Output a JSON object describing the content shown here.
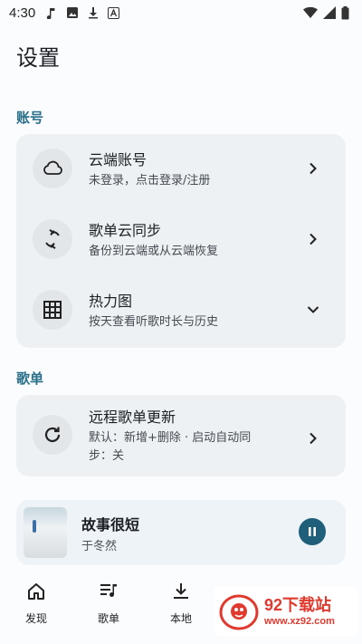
{
  "status_bar": {
    "time": "4:30"
  },
  "page": {
    "title": "设置"
  },
  "sections": {
    "account_label": "账号",
    "playlist_label": "歌单"
  },
  "account_rows": [
    {
      "title": "云端账号",
      "subtitle": "未登录，点击登录/注册",
      "icon": "cloud-icon",
      "trailing": "chevron-right-icon"
    },
    {
      "title": "歌单云同步",
      "subtitle": "备份到云端或从云端恢复",
      "icon": "sync-icon",
      "trailing": "chevron-right-icon"
    },
    {
      "title": "热力图",
      "subtitle": "按天查看听歌时长与历史",
      "icon": "grid-icon",
      "trailing": "chevron-down-icon"
    }
  ],
  "playlist_rows": [
    {
      "title": "远程歌单更新",
      "subtitle_line1": "默认：新增+删除 · 启动自动同",
      "subtitle_line2": "步：关",
      "icon": "refresh-icon",
      "trailing": "chevron-right-icon"
    }
  ],
  "player": {
    "song": "故事很短",
    "artist": "于冬然",
    "state": "playing"
  },
  "bottom_nav": [
    {
      "label": "发现",
      "icon": "home-icon"
    },
    {
      "label": "歌单",
      "icon": "playlist-icon"
    },
    {
      "label": "本地",
      "icon": "download-icon"
    }
  ],
  "watermark": {
    "brand": "92下载站",
    "url": "www.xz92.com"
  },
  "colors": {
    "accent": "#2a6f8a",
    "card_bg": "#eef1f3",
    "pause_bg": "#1f5f7a",
    "watermark": "#e03a2f"
  }
}
